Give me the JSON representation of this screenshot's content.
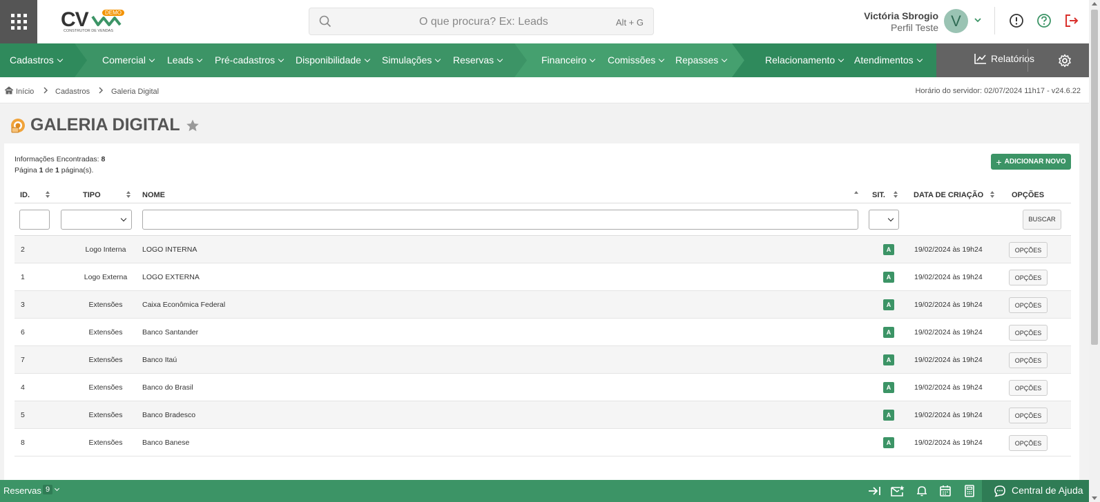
{
  "header": {
    "logo": {
      "text": "CV",
      "badge": "DEMO",
      "subtitle": "CONSTRUTOR DE VENDAS"
    },
    "search": {
      "placeholder": "O que procura? Ex: Leads",
      "shortcut": "Alt + G"
    },
    "user": {
      "name": "Victória Sbrogio",
      "profile": "Perfil Teste",
      "initial": "V"
    }
  },
  "nav": {
    "items": [
      "Cadastros",
      "Comercial",
      "Leads",
      "Pré-cadastros",
      "Disponibilidade",
      "Simulações",
      "Reservas",
      "Financeiro",
      "Comissões",
      "Repasses",
      "Relacionamento",
      "Atendimentos"
    ],
    "reports": "Relatórios"
  },
  "breadcrumb": {
    "items": [
      "Início",
      "Cadastros",
      "Galeria Digital"
    ],
    "server": "Horário do servidor: 02/07/2024 11h17 - v24.6.22"
  },
  "page": {
    "title": "GALERIA DIGITAL",
    "info_label": "Informações Encontradas:",
    "info_count": "8",
    "page_word": "Página",
    "page_current": "1",
    "page_of": "de",
    "page_total": "1",
    "page_suffix": "página(s).",
    "add_button": "ADICIONAR NOVO",
    "search_button": "BUSCAR"
  },
  "table": {
    "columns": {
      "id": "ID.",
      "tipo": "TIPO",
      "nome": "NOME",
      "sit": "SIT.",
      "data": "DATA DE CRIAÇÃO",
      "opcoes": "OPÇÕES"
    },
    "rows": [
      {
        "id": "2",
        "tipo": "Logo Interna",
        "nome": "LOGO INTERNA",
        "sit": "A",
        "data": "19/02/2024 às 19h24",
        "op": "OPÇÕES"
      },
      {
        "id": "1",
        "tipo": "Logo Externa",
        "nome": "LOGO EXTERNA",
        "sit": "A",
        "data": "19/02/2024 às 19h24",
        "op": "OPÇÕES"
      },
      {
        "id": "3",
        "tipo": "Extensões",
        "nome": "Caixa Econômica Federal",
        "sit": "A",
        "data": "19/02/2024 às 19h24",
        "op": "OPÇÕES"
      },
      {
        "id": "6",
        "tipo": "Extensões",
        "nome": "Banco Santander",
        "sit": "A",
        "data": "19/02/2024 às 19h24",
        "op": "OPÇÕES"
      },
      {
        "id": "7",
        "tipo": "Extensões",
        "nome": "Banco Itaú",
        "sit": "A",
        "data": "19/02/2024 às 19h24",
        "op": "OPÇÕES"
      },
      {
        "id": "4",
        "tipo": "Extensões",
        "nome": "Banco do Brasil",
        "sit": "A",
        "data": "19/02/2024 às 19h24",
        "op": "OPÇÕES"
      },
      {
        "id": "5",
        "tipo": "Extensões",
        "nome": "Banco Bradesco",
        "sit": "A",
        "data": "19/02/2024 às 19h24",
        "op": "OPÇÕES"
      },
      {
        "id": "8",
        "tipo": "Extensões",
        "nome": "Banco Banese",
        "sit": "A",
        "data": "19/02/2024 às 19h24",
        "op": "OPÇÕES"
      }
    ]
  },
  "footer": {
    "reservas_label": "Reservas",
    "reservas_count": "9",
    "help": "Central de Ajuda"
  },
  "colors": {
    "primary": "#3c9466",
    "dark": "#2f7c55",
    "logout": "#d9302c"
  }
}
